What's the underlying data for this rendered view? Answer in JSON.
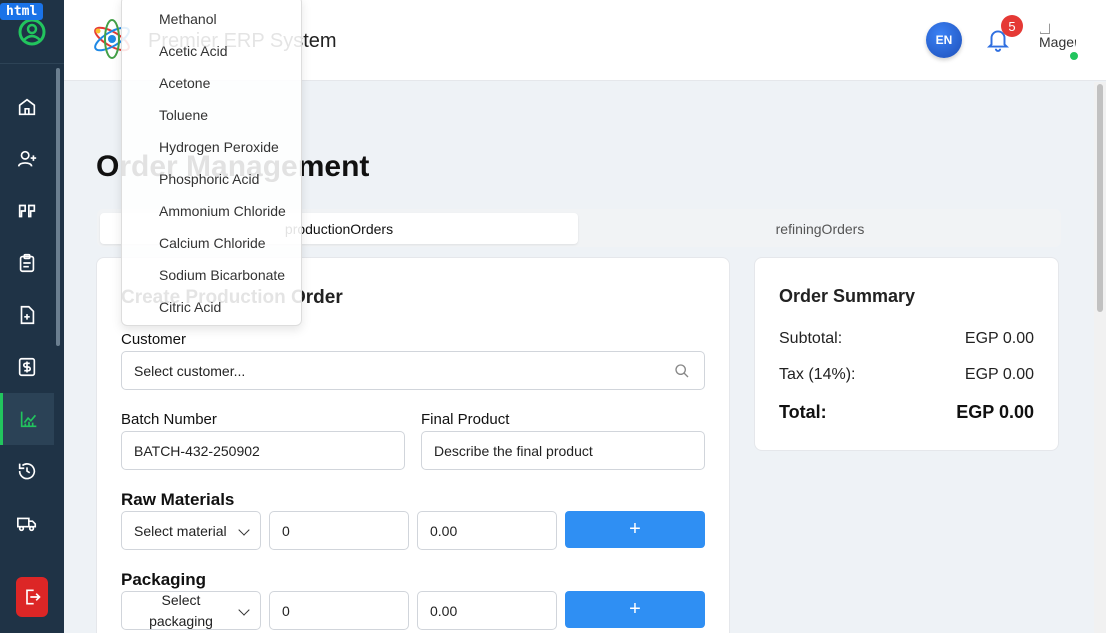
{
  "badge": "html",
  "app": {
    "title": "Premier ERP System"
  },
  "header": {
    "lang": "EN",
    "notifications": "5",
    "avatar_alt": "Mager"
  },
  "sidebar": {
    "items": [
      {
        "icon": "home-icon"
      },
      {
        "icon": "add-user-icon"
      },
      {
        "icon": "quote-icon"
      },
      {
        "icon": "clipboard-icon"
      },
      {
        "icon": "file-plus-icon"
      },
      {
        "icon": "dollar-icon"
      },
      {
        "icon": "chart-icon"
      },
      {
        "icon": "history-icon"
      },
      {
        "icon": "truck-icon"
      }
    ],
    "logout_icon": "logout-icon",
    "accent": "#22c55e"
  },
  "page": {
    "title": "Order Management"
  },
  "tabs": [
    {
      "label": "productionOrders",
      "active": true
    },
    {
      "label": "refiningOrders",
      "active": false
    }
  ],
  "form": {
    "title": "Create Production Order",
    "customer_label": "Customer",
    "customer_placeholder": "Select customer...",
    "batch_label": "Batch Number",
    "batch_value": "BATCH-432-250902",
    "final_label": "Final Product",
    "final_placeholder": "Describe the final product",
    "raw_label": "Raw Materials",
    "raw_select": "Select material",
    "raw_qty": "0",
    "raw_price": "0.00",
    "packaging_label": "Packaging",
    "pack_select": "Select packaging",
    "pack_qty": "0",
    "pack_price": "0.00",
    "add_label": "+"
  },
  "summary": {
    "title": "Order Summary",
    "subtotal_label": "Subtotal:",
    "subtotal_value": "EGP 0.00",
    "tax_label": "Tax (14%):",
    "tax_value": "EGP 0.00",
    "total_label": "Total:",
    "total_value": "EGP 0.00"
  },
  "dropdown": {
    "options": [
      "Methanol",
      "Acetic Acid",
      "Acetone",
      "Toluene",
      "Hydrogen Peroxide",
      "Phosphoric Acid",
      "Ammonium Chloride",
      "Calcium Chloride",
      "Sodium Bicarbonate",
      "Citric Acid"
    ]
  },
  "colors": {
    "sidebar": "#1f3346",
    "primary": "#2f8ff3",
    "danger": "#dc2626"
  }
}
